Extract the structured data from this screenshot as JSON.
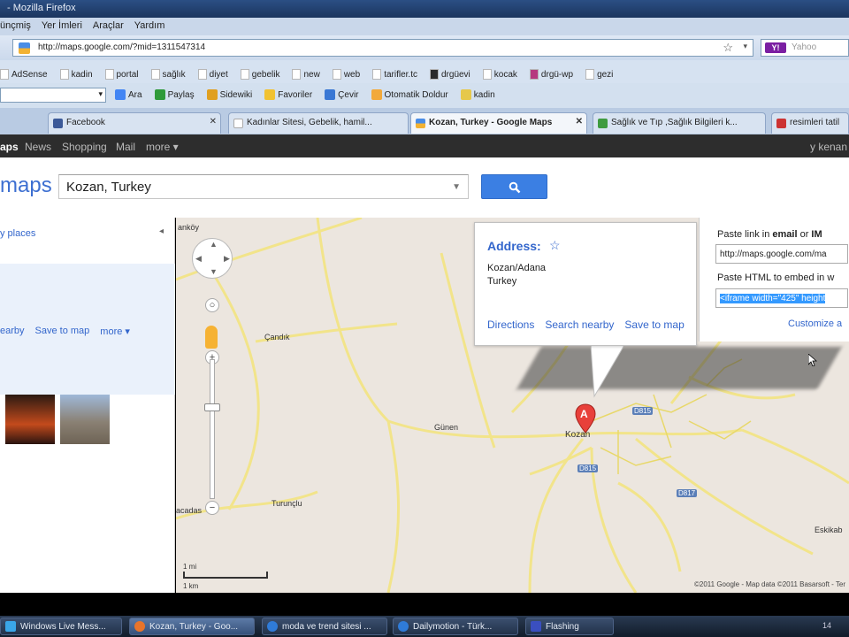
{
  "browser": {
    "title": "- Mozilla Firefox",
    "menu": [
      "ünçmiş",
      "Yer İmleri",
      "Araçlar",
      "Yardım"
    ],
    "url": "http://maps.google.com/?mid=1311547314",
    "search_placeholder": "Yahoo"
  },
  "bookmarks": [
    "AdSense",
    "kadin",
    "portal",
    "sağlık",
    "diyet",
    "gebelik",
    "new",
    "web",
    "tarifler.tc",
    "drgüevi",
    "kocak",
    "drgü-wp",
    "gezi"
  ],
  "toolbar2": {
    "items": [
      "Ara",
      "Paylaş",
      "Sidewiki",
      "Favoriler",
      "Çevir",
      "Otomatik Doldur",
      "kadin"
    ]
  },
  "tabs": [
    {
      "label": "Facebook",
      "active": false
    },
    {
      "label": "Kadınlar Sitesi, Gebelik, hamil...",
      "active": false
    },
    {
      "label": "Kozan, Turkey - Google Maps",
      "active": true
    },
    {
      "label": "Sağlık ve Tıp ,Sağlık Bilgileri k...",
      "active": false
    },
    {
      "label": "resimleri tatil",
      "active": false
    }
  ],
  "google_bar": {
    "items": [
      "aps",
      "News",
      "Shopping",
      "Mail",
      "more ▾"
    ],
    "user": "y kenan"
  },
  "maps": {
    "logo": "maps",
    "search_value": "Kozan, Turkey"
  },
  "left_panel": {
    "places_link": "y places",
    "links": [
      "earby",
      "Save to map",
      "more ▾"
    ]
  },
  "map": {
    "places": [
      "anköy",
      "Çandık",
      "Günen",
      "Kozan",
      "Turunçlu",
      "acadas",
      "Eskikab"
    ],
    "marker_letter": "A",
    "road_badges": [
      "D815",
      "D815",
      "D817"
    ],
    "scale_mi": "1 mi",
    "scale_km": "1 km",
    "copyright": "©2011 Google - Map data ©2011 Basarsoft - Ter"
  },
  "info_window": {
    "title": "Address:",
    "line1": "Kozan/Adana",
    "line2": "Turkey",
    "links": [
      "Directions",
      "Search nearby",
      "Save to map"
    ]
  },
  "link_panel": {
    "email_label_prefix": "Paste link in ",
    "email_label_bold1": "email",
    "email_label_mid": " or ",
    "email_label_bold2": "IM",
    "link_value": "http://maps.google.com/ma",
    "html_label": "Paste HTML to embed in w",
    "html_value": "<iframe width=\"425\" height",
    "customize": "Customize a"
  },
  "taskbar": {
    "items": [
      "Windows Live Mess...",
      "Kozan, Turkey - Goo...",
      "moda ve trend sitesi ...",
      "Dailymotion - Türk...",
      "Flashing"
    ],
    "time": "14"
  },
  "colors": {
    "link": "#3366cc",
    "search_button": "#3b7fe3",
    "marker": "#e8403a",
    "road": "#f2e48a"
  }
}
